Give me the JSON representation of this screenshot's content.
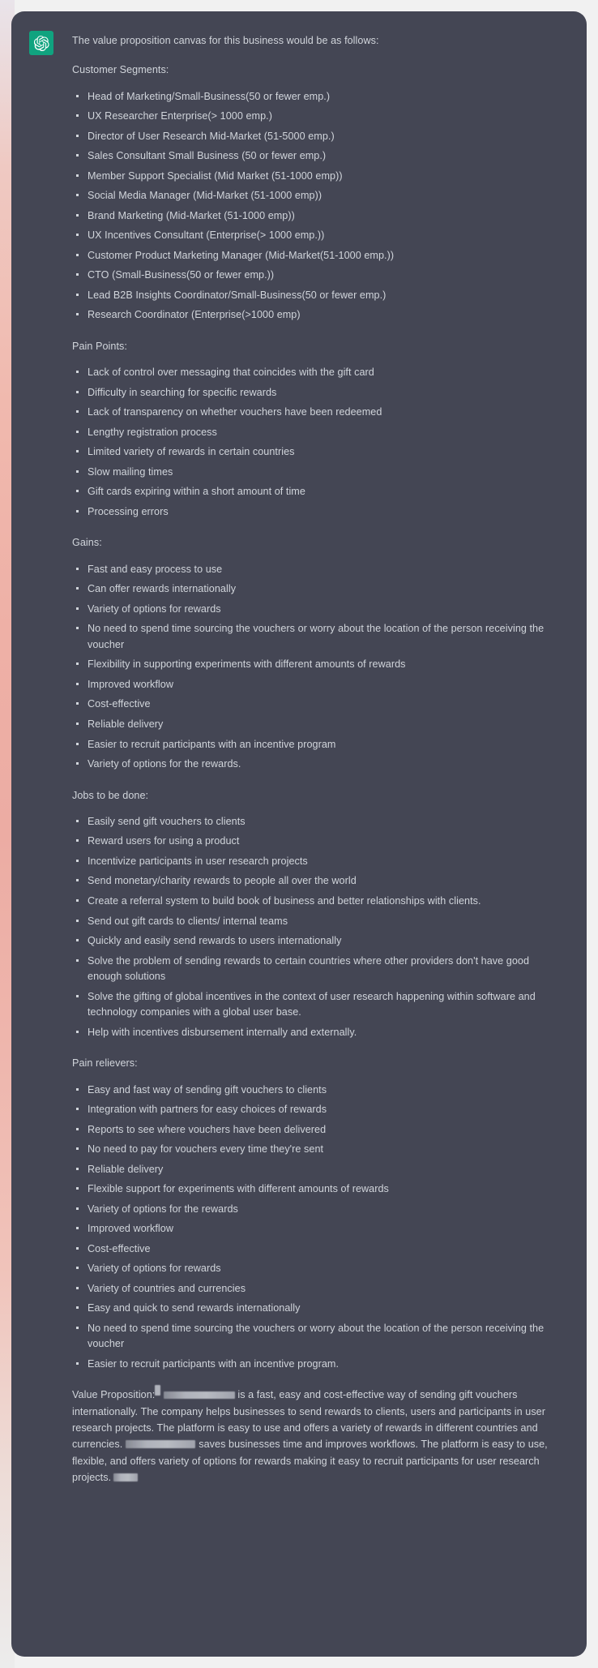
{
  "window": {
    "background_color": "#f1f1f1",
    "card_background_color": "#444654",
    "text_color": "#d1d5db",
    "accent_color": "#10a37f"
  },
  "message": {
    "author_icon": "chatgpt-logo-icon",
    "intro": "The value proposition canvas for this business would be as follows:",
    "sections": [
      {
        "heading": "Customer Segments:",
        "items": [
          "Head of Marketing/Small-Business(50 or fewer emp.)",
          "UX Researcher Enterprise(> 1000 emp.)",
          "Director of User Research Mid-Market (51-5000 emp.)",
          "Sales Consultant Small Business (50 or fewer emp.)",
          "Member Support Specialist (Mid Market (51-1000 emp))",
          "Social Media Manager (Mid-Market (51-1000 emp))",
          "Brand Marketing (Mid-Market (51-1000 emp))",
          "UX Incentives Consultant (Enterprise(> 1000 emp.))",
          "Customer Product Marketing Manager (Mid-Market(51-1000 emp.))",
          "CTO (Small-Business(50 or fewer emp.))",
          "Lead B2B Insights Coordinator/Small-Business(50 or fewer emp.)",
          "Research Coordinator (Enterprise(>1000 emp)"
        ]
      },
      {
        "heading": "Pain Points:",
        "items": [
          "Lack of control over messaging that coincides with the gift card",
          "Difficulty in searching for specific rewards",
          "Lack of transparency on whether vouchers have been redeemed",
          "Lengthy registration process",
          "Limited variety of rewards in certain countries",
          "Slow mailing times",
          "Gift cards expiring within a short amount of time",
          "Processing errors"
        ]
      },
      {
        "heading": "Gains:",
        "items": [
          "Fast and easy process to use",
          "Can offer rewards internationally",
          "Variety of options for rewards",
          "No need to spend time sourcing the vouchers or worry about the location of the person receiving the voucher",
          "Flexibility in supporting experiments with different amounts of rewards",
          "Improved workflow",
          "Cost-effective",
          "Reliable delivery",
          "Easier to recruit participants with an incentive program",
          "Variety of options for the rewards."
        ]
      },
      {
        "heading": "Jobs to be done:",
        "items": [
          "Easily send gift vouchers to clients",
          "Reward users for using a product",
          "Incentivize participants in user research projects",
          "Send monetary/charity rewards to people all over the world",
          "Create a referral system to build book of business and better relationships with clients.",
          "Send out gift cards to clients/ internal teams",
          "Quickly and easily send rewards to users internationally",
          "Solve the problem of sending rewards to certain countries where other providers don't have good enough solutions",
          "Solve the gifting of global incentives in the context of user research happening within software and technology companies with a global user base.",
          "Help with incentives disbursement internally and externally."
        ]
      },
      {
        "heading": "Pain relievers:",
        "items": [
          "Easy and fast way of sending gift vouchers to clients",
          "Integration with partners for easy choices of rewards",
          "Reports to see where vouchers have been delivered",
          "No need to pay for vouchers every time they're sent",
          "Reliable delivery",
          "Flexible support for experiments with different amounts of rewards",
          "Variety of options for the rewards",
          "Improved workflow",
          "Cost-effective",
          "Variety of options for rewards",
          "Variety of countries and currencies",
          "Easy and quick to send rewards internationally",
          "No need to spend time sourcing the vouchers or worry about the location of the person receiving the voucher",
          "Easier to recruit participants with an incentive program."
        ]
      }
    ],
    "value_proposition": {
      "label": "Value Proposition:",
      "redacted_1": "[redacted]",
      "part_1": "is a fast, easy and cost-effective way of sending gift vouchers internationally. The company helps businesses to send rewards to clients, users and participants in user research projects. The platform is easy to use and offers a variety of rewards in different countries and currencies.",
      "redacted_2": "[redacted]",
      "part_2": "saves businesses time and improves workflows. The platform is easy to use, flexible, and offers variety of options for rewards making it easy to recruit participants for user research projects.",
      "redacted_3": "[redacted]"
    }
  }
}
